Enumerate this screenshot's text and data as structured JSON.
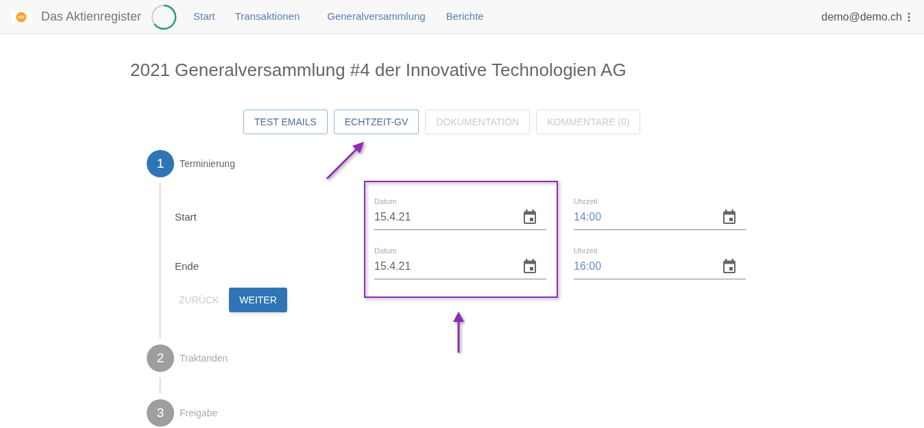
{
  "navbar": {
    "brand": "Das Aktienregister",
    "links": [
      {
        "label": "Start"
      },
      {
        "label": "Transaktionen"
      },
      {
        "label": "Generalversammlung"
      },
      {
        "label": "Berichte"
      }
    ],
    "user": "demo@demo.ch"
  },
  "title": "2021 Generalversammlung #4 der Innovative Technologien AG",
  "action_buttons": [
    {
      "label": "TEST EMAILS",
      "disabled": false
    },
    {
      "label": "ECHTZEIT-GV",
      "disabled": false
    },
    {
      "label": "DOKUMENTATION",
      "disabled": true
    },
    {
      "label": "KOMMENTARE (0)",
      "disabled": true
    }
  ],
  "steps": [
    {
      "number": "1",
      "label": "Terminierung",
      "active": true,
      "rows": [
        {
          "label": "Start",
          "fields": [
            {
              "label": "Datum",
              "value": "15.4.21"
            },
            {
              "label": "Uhrzeit",
              "value": "14:00"
            }
          ]
        },
        {
          "label": "Ende",
          "fields": [
            {
              "label": "Datum",
              "value": "15.4.21"
            },
            {
              "label": "Uhrzeit",
              "value": "16:00"
            }
          ]
        }
      ],
      "back_button": {
        "label": "ZURÜCK",
        "disabled": true
      },
      "next_button": {
        "label": "WEITER",
        "disabled": false
      }
    },
    {
      "number": "2",
      "label": "Traktanden",
      "active": false
    },
    {
      "number": "3",
      "label": "Freigabe",
      "active": false
    }
  ]
}
